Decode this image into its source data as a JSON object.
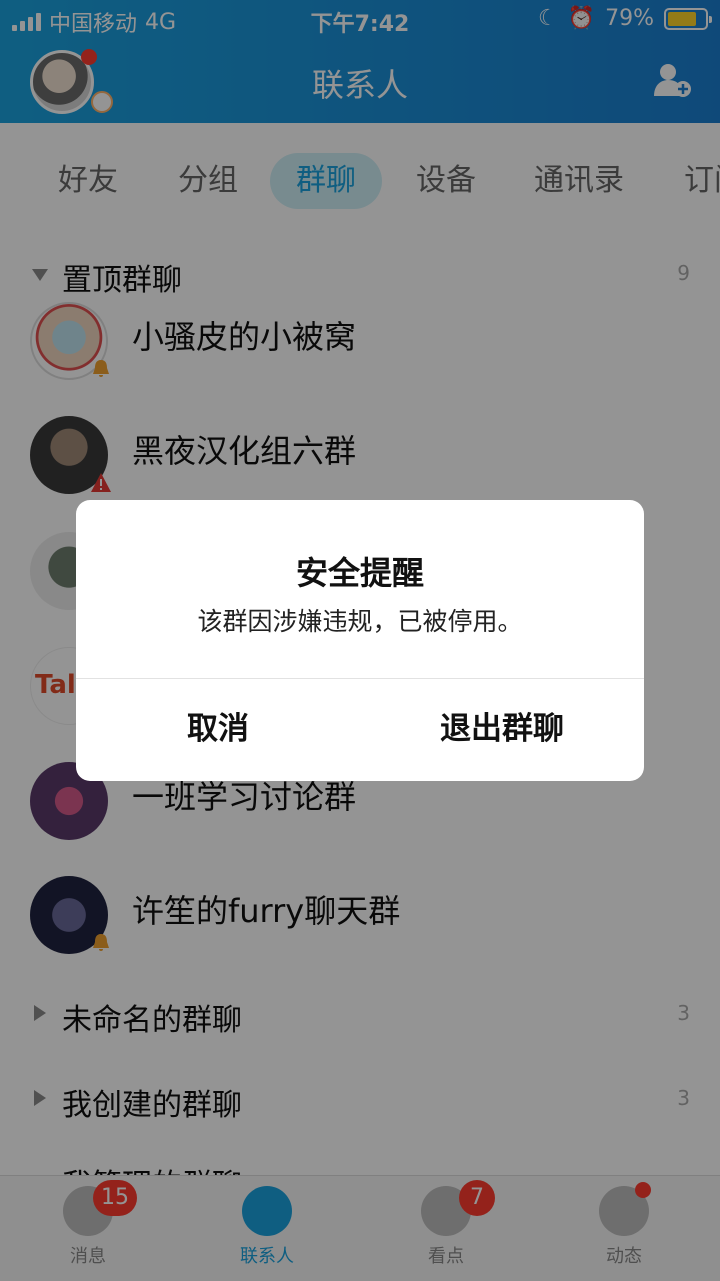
{
  "status_bar": {
    "carrier": "中国移动",
    "network": "4G",
    "time": "下午7:42",
    "battery": "79%"
  },
  "header": {
    "title": "联系人"
  },
  "tabs": [
    {
      "label": "好友",
      "active": false
    },
    {
      "label": "分组",
      "active": false
    },
    {
      "label": "群聊",
      "active": true
    },
    {
      "label": "设备",
      "active": false
    },
    {
      "label": "通讯录",
      "active": false
    },
    {
      "label": "订阅",
      "active": false
    }
  ],
  "sections": {
    "pinned": {
      "label": "置顶群聊",
      "count": "9"
    },
    "unnamed": {
      "label": "未命名的群聊",
      "count": "3"
    },
    "created": {
      "label": "我创建的群聊",
      "count": "3"
    },
    "managed": {
      "label": "我管理的群聊"
    }
  },
  "groups": [
    {
      "name": "小骚皮的小被窝",
      "badge": "bell-icon"
    },
    {
      "name": "黑夜汉化组六群",
      "badge": "warning-icon"
    },
    {
      "name": "一班学习讨论群"
    },
    {
      "name": "许笙的furry聊天群",
      "badge": "bell-icon"
    }
  ],
  "dialog": {
    "title": "安全提醒",
    "message": "该群因涉嫌违规，已被停用。",
    "cancel_label": "取消",
    "exit_label": "退出群聊"
  },
  "bottom_nav": {
    "messages": {
      "label": "消息",
      "badge": "15"
    },
    "contacts": {
      "label": "联系人"
    },
    "watch": {
      "label": "看点",
      "badge": "7"
    },
    "feed": {
      "label": "动态"
    }
  },
  "colors": {
    "accent": "#1aa3df",
    "badge_red": "#ff3b30",
    "battery_yellow": "#ffd42a"
  }
}
